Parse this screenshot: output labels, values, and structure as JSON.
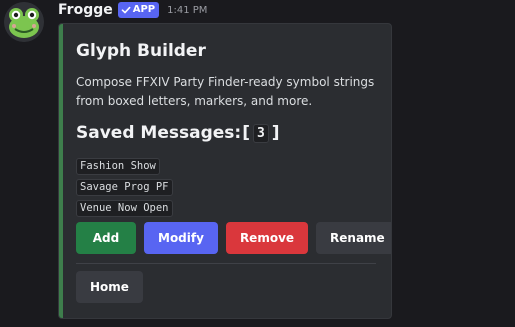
{
  "message": {
    "username": "Frogge",
    "badge": "APP",
    "timestamp": "1:41 PM"
  },
  "embed": {
    "title": "Glyph Builder",
    "description": "Compose FFXIV Party Finder-ready symbol strings from boxed letters, markers, and more.",
    "saved_label": "Saved Messages: ",
    "saved_count": "3",
    "saved_items": [
      "Fashion Show",
      "Savage Prog PF",
      "Venue Now Open"
    ],
    "accent_color": "#3e7e4c"
  },
  "buttons": {
    "add": "Add",
    "modify": "Modify",
    "remove": "Remove",
    "rename": "Rename",
    "home": "Home"
  },
  "colors": {
    "success": "#248046",
    "primary": "#5865f2",
    "danger": "#da373c",
    "secondary": "#393b41"
  },
  "icons": {
    "avatar": "frog-avatar-icon",
    "badge_check": "checkmark-icon"
  }
}
